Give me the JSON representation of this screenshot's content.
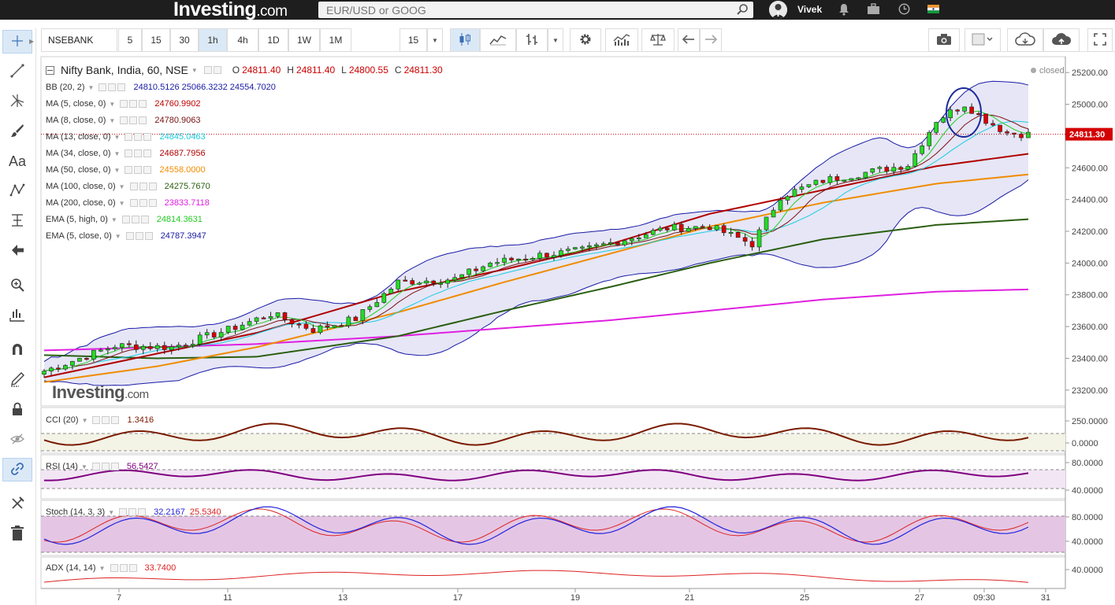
{
  "topbar": {
    "logo": "Investing",
    "logo_suffix": ".com",
    "search_placeholder": "EUR/USD or GOOG",
    "username": "Vivek",
    "icons": [
      "search-icon",
      "bell-icon",
      "briefcase-icon",
      "clock-icon",
      "india-flag-icon"
    ]
  },
  "toolbar": {
    "symbol": "NSEBANK",
    "intervals": [
      "5",
      "15",
      "30",
      "1h",
      "4h",
      "1D",
      "1W",
      "1M"
    ],
    "active_interval": "1h",
    "extra_interval": "15",
    "icons": [
      "candle-icon",
      "line-chart-icon",
      "bar-chart-icon",
      "chevron-down-icon",
      "gear-icon",
      "indicators-icon",
      "compare-icon",
      "undo-icon",
      "redo-icon",
      "camera-icon",
      "color-icon",
      "cloud-download-icon",
      "cloud-upload-icon",
      "fullscreen-icon"
    ]
  },
  "sidebar": {
    "tools": [
      "crosshair-icon",
      "trendline-icon",
      "fib-icon",
      "brush-icon",
      "text-icon",
      "pattern-icon",
      "measure-icon",
      "back-arrow-icon",
      "zoom-icon",
      "ruler-icon",
      "magnet-icon",
      "pencil-lock-icon",
      "lock-icon",
      "eye-icon",
      "link-icon",
      "delete-tools-icon",
      "trash-icon"
    ]
  },
  "header": {
    "title": "Nifty Bank, India, 60, NSE",
    "ohlc": [
      {
        "k": "O",
        "v": "24811.40"
      },
      {
        "k": "H",
        "v": "24811.40"
      },
      {
        "k": "L",
        "v": "24800.55"
      },
      {
        "k": "C",
        "v": "24811.30"
      }
    ],
    "status": "closed"
  },
  "indicators": [
    {
      "name": "BB (20, 2)",
      "values": "24810.5126  25066.3232  24554.7020",
      "color": "#1a1aa6"
    },
    {
      "name": "MA (5, close, 0)",
      "values": "24760.9902",
      "color": "#c00000"
    },
    {
      "name": "MA (8, close, 0)",
      "values": "24780.9063",
      "color": "#7a1010"
    },
    {
      "name": "MA (13, close, 0)",
      "values": "24845.0463",
      "color": "#1bcde0"
    },
    {
      "name": "MA (34, close, 0)",
      "values": "24687.7956",
      "color": "#b00000"
    },
    {
      "name": "MA (50, close, 0)",
      "values": "24558.0000",
      "color": "#f08c00"
    },
    {
      "name": "MA (100, close, 0)",
      "values": "24275.7670",
      "color": "#2a5e10"
    },
    {
      "name": "MA (200, close, 0)",
      "values": "23833.7118",
      "color": "#e020e0"
    },
    {
      "name": "EMA (5, high, 0)",
      "values": "24814.3631",
      "color": "#22cc22"
    },
    {
      "name": "EMA (5, close, 0)",
      "values": "24787.3947",
      "color": "#1a1aa6"
    }
  ],
  "price_axis": {
    "ticks": [
      "25200.00",
      "25000.00",
      "24800.00",
      "24600.00",
      "24400.00",
      "24200.00",
      "24000.00",
      "23800.00",
      "23600.00",
      "23400.00",
      "23200.00"
    ],
    "last_price": "24811.30",
    "last_price_color": "#d40000"
  },
  "time_axis": {
    "ticks": [
      "7",
      "11",
      "13",
      "17",
      "19",
      "21",
      "25",
      "27",
      "09:30",
      "31"
    ]
  },
  "panes": {
    "cci": {
      "name": "CCI (20)",
      "value": "1.3416",
      "color": "#7a1a00",
      "ticks": [
        "250.0000",
        "0.0000"
      ]
    },
    "rsi": {
      "name": "RSI (14)",
      "value": "56.5427",
      "color": "#800080",
      "ticks": [
        "80.0000",
        "40.0000"
      ]
    },
    "stoch": {
      "name": "Stoch (14, 3, 3)",
      "value1": "32.2167",
      "value2": "25.5340",
      "color1": "#2222dd",
      "color2": "#dd2222",
      "ticks": [
        "80.0000",
        "40.0000"
      ]
    },
    "adx": {
      "name": "ADX (14, 14)",
      "value": "33.7400",
      "color": "#dd2222",
      "ticks": [
        "40.0000"
      ]
    }
  },
  "watermark": {
    "text": "Investing",
    "suffix": ".com"
  },
  "chart_data": {
    "type": "line",
    "title": "Nifty Bank, India, 60, NSE",
    "ylim": [
      23100,
      25300
    ],
    "x": [
      "7",
      "11",
      "13",
      "17",
      "19",
      "21",
      "25",
      "27",
      "09:30",
      "31"
    ],
    "series": [
      {
        "name": "MA (200, close, 0)",
        "values": [
          23450,
          23470,
          23490,
          23540,
          23590,
          23640,
          23700,
          23770,
          23820,
          23834
        ]
      },
      {
        "name": "MA (100, close, 0)",
        "values": [
          23420,
          23400,
          23410,
          23540,
          23700,
          23850,
          24000,
          24150,
          24240,
          24276
        ]
      },
      {
        "name": "MA (50, close, 0)",
        "values": [
          23250,
          23350,
          23470,
          23690,
          23880,
          24060,
          24230,
          24380,
          24500,
          24558
        ]
      },
      {
        "name": "MA (34, close, 0)",
        "values": [
          23280,
          23430,
          23560,
          23820,
          23960,
          24120,
          24310,
          24460,
          24610,
          24688
        ]
      }
    ]
  }
}
